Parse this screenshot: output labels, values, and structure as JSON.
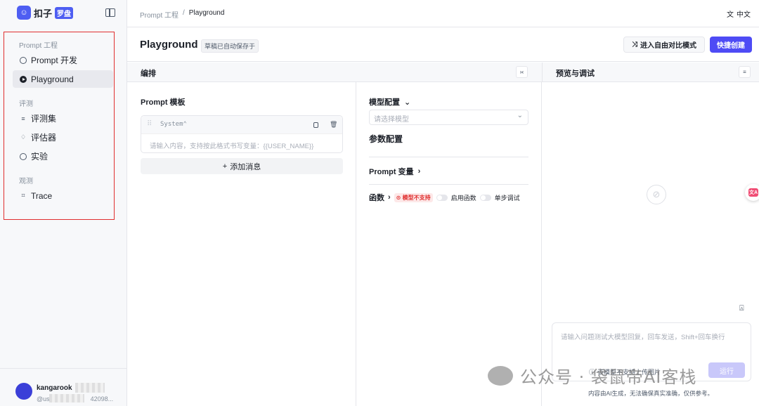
{
  "brand": {
    "name": "扣子",
    "badge": "罗盘"
  },
  "sidebar": {
    "sections": [
      {
        "title": "Prompt 工程",
        "items": [
          {
            "label": "Prompt 开发"
          },
          {
            "label": "Playground"
          }
        ]
      },
      {
        "title": "评测",
        "items": [
          {
            "label": "评测集"
          },
          {
            "label": "评估器"
          },
          {
            "label": "实验"
          }
        ]
      },
      {
        "title": "观测",
        "items": [
          {
            "label": "Trace"
          }
        ]
      }
    ],
    "active_item": "Playground",
    "user": {
      "name": "kangarook",
      "id_masked": "@us",
      "id_tail": "42098..."
    }
  },
  "breadcrumb": {
    "parent": "Prompt 工程",
    "separator": "/",
    "current": "Playground"
  },
  "language": "中文",
  "header": {
    "title": "Playground",
    "draft_badge": "草稿已自动保存于",
    "compare_button": "进入自由对比模式",
    "create_button": "快捷创建"
  },
  "panels": {
    "edit": "编排",
    "preview": "预览与调试"
  },
  "prompt_template": {
    "title": "Prompt 模板",
    "message_role": "System",
    "message_placeholder": "请输入内容，支持按此格式书写变量：{{USER_NAME}}",
    "add_message": "添加消息"
  },
  "config": {
    "model_config": "模型配置",
    "model_placeholder": "请选择模型",
    "param_config": "参数配置",
    "prompt_vars": "Prompt 变量",
    "functions": "函数",
    "not_supported": "模型不支持",
    "enable_functions": "启用函数",
    "step_debug": "单步调试"
  },
  "preview": {
    "chat_placeholder": "请输入问题测试大模型回复，回车发送，Shift+回车换行",
    "chat_hint": "该模型不支持上传图片",
    "send": "运行",
    "disclaimer": "内容由AI生成，无法确保真实准确，仅供参考。"
  },
  "float_badge": "文A",
  "watermark": "公众号 · 袋鼠帝AI客栈",
  "colors": {
    "accent": "#4e4bf5",
    "highlight_box": "#e02f2f",
    "danger": "#e02f2f"
  }
}
